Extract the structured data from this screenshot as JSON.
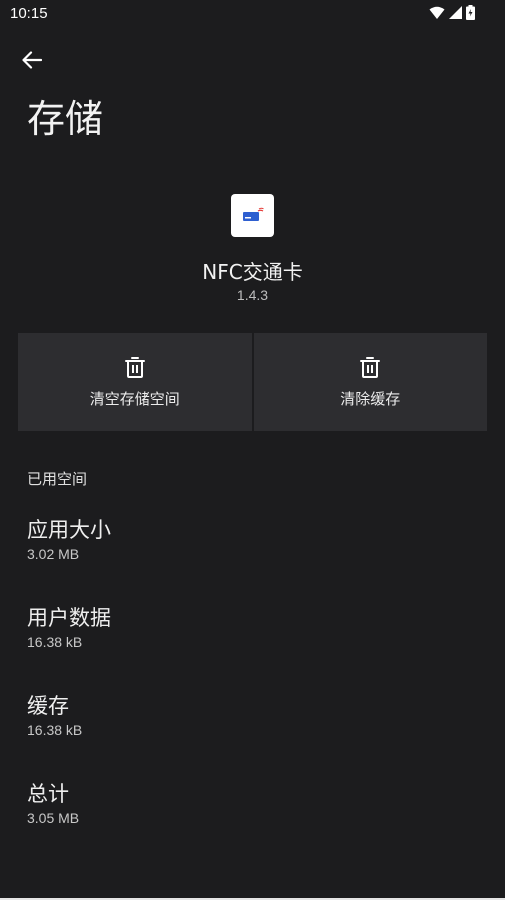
{
  "status_bar": {
    "time": "10:15",
    "icons": [
      "wifi-icon",
      "signal-icon",
      "battery-icon"
    ]
  },
  "header": {
    "back_icon": "back-arrow-icon",
    "title": "存储"
  },
  "app": {
    "icon": "nfc-card-app-icon",
    "name": "NFC交通卡",
    "version": "1.4.3"
  },
  "actions": [
    {
      "icon": "trash-icon",
      "label": "清空存储空间"
    },
    {
      "icon": "trash-icon",
      "label": "清除缓存"
    }
  ],
  "storage": {
    "section_title": "已用空间",
    "items": [
      {
        "label": "应用大小",
        "value": "3.02 MB"
      },
      {
        "label": "用户数据",
        "value": "16.38 kB"
      },
      {
        "label": "缓存",
        "value": "16.38 kB"
      },
      {
        "label": "总计",
        "value": "3.05 MB"
      }
    ]
  },
  "colors": {
    "background": "#1c1c1e",
    "button_bg": "#2d2d30",
    "text_primary": "#eeeeee",
    "text_secondary": "#c8c8c8"
  }
}
